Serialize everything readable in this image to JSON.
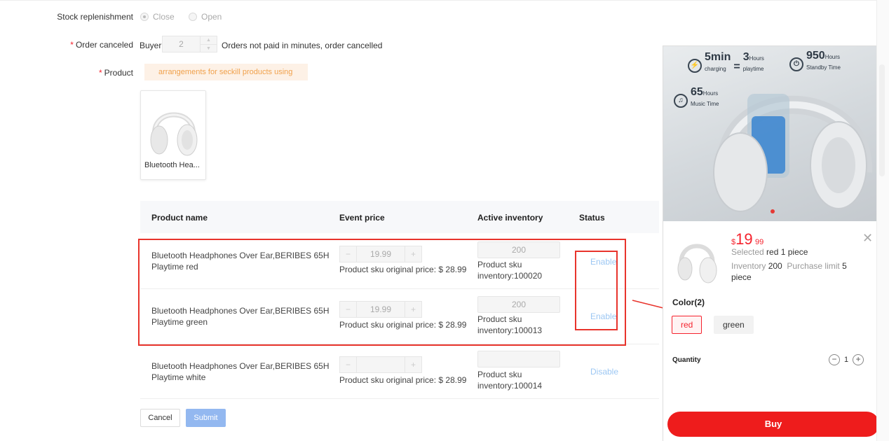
{
  "form": {
    "stock_replenishment": {
      "label": "Stock replenishment",
      "options": [
        "Close",
        "Open"
      ],
      "selected": "Close"
    },
    "order_canceled": {
      "required_mark": "*",
      "label": "Order canceled",
      "prefix": "Buyer",
      "value": "2",
      "suffix": "Orders not paid in minutes, order cancelled"
    },
    "product": {
      "required_mark": "*",
      "label": "Product",
      "notice": "arrangements for seckill products using",
      "card_name": "Bluetooth Hea..."
    }
  },
  "table": {
    "headers": [
      "Product name",
      "Event price",
      "Active inventory",
      "Status"
    ],
    "rows": [
      {
        "name_line1": "Bluetooth Headphones Over Ear,BERIBES 65H",
        "name_line2": "Playtime red",
        "price": "19.99",
        "orig_price": "Product sku original price: $ 28.99",
        "inventory": "200",
        "sku_line1": "Product sku",
        "sku_line2": "inventory:100020",
        "status": "Enable"
      },
      {
        "name_line1": "Bluetooth Headphones Over Ear,BERIBES 65H",
        "name_line2": "Playtime green",
        "price": "19.99",
        "orig_price": "Product sku original price: $ 28.99",
        "inventory": "200",
        "sku_line1": "Product sku",
        "sku_line2": "inventory:100013",
        "status": "Enable"
      },
      {
        "name_line1": "Bluetooth Headphones Over Ear,BERIBES 65H",
        "name_line2": "Playtime white",
        "price": "",
        "orig_price": "Product sku original price: $ 28.99",
        "inventory": "",
        "sku_line1": "Product sku",
        "sku_line2": "inventory:100014",
        "status": "Disable"
      }
    ]
  },
  "buttons": {
    "cancel": "Cancel",
    "submit": "Submit"
  },
  "preview": {
    "banner": {
      "feat1_big": "5min",
      "feat1_small": "charging",
      "feat1_eq": "=",
      "feat1_big2": "3",
      "feat1_unit2": "Hours",
      "feat1_small2": "playtime",
      "feat2_big": "950",
      "feat2_unit": "Hours",
      "feat2_small": "Standby Time",
      "feat3_big": "65",
      "feat3_unit": "Hours",
      "feat3_small": "Music Time"
    },
    "price_currency": "$",
    "price_int": "19",
    "price_dec": "99",
    "selected_prefix": "Selected",
    "selected_value": "red 1  piece",
    "inventory_label": "Inventory",
    "inventory_value": "200",
    "limit_label": "Purchase limit",
    "limit_value": "5",
    "limit_unit": "piece",
    "color_label": "Color(2)",
    "colors": [
      "red",
      "green"
    ],
    "quantity_label": "Quantity",
    "quantity": "1",
    "buy_label": "Buy"
  },
  "colors": {
    "accent_red": "#ee1c1c",
    "link_blue": "#9cc7f3",
    "highlight_rect": "#e8342c",
    "submit_blue": "#93b8f0"
  }
}
